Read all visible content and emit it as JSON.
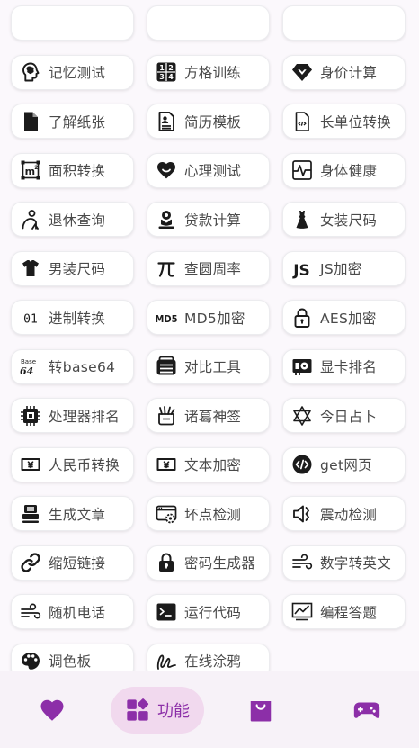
{
  "colors": {
    "accent": "#8c2fa8",
    "icon": "#1b1b1b",
    "text": "#4a4a4a",
    "active_bg": "#f1d9ee"
  },
  "tools": [
    {
      "label": "",
      "icon": "blank-icon"
    },
    {
      "label": "",
      "icon": "blank-icon"
    },
    {
      "label": "",
      "icon": "blank-icon"
    },
    {
      "label": "记忆测试",
      "icon": "brain-head-icon"
    },
    {
      "label": "方格训练",
      "icon": "number-grid-icon"
    },
    {
      "label": "身价计算",
      "icon": "diamond-icon"
    },
    {
      "label": "了解纸张",
      "icon": "paper-icon"
    },
    {
      "label": "简历模板",
      "icon": "resume-icon"
    },
    {
      "label": "长单位转换",
      "icon": "code-file-icon"
    },
    {
      "label": "面积转换",
      "icon": "area-m2-icon"
    },
    {
      "label": "心理测试",
      "icon": "heart-smile-icon"
    },
    {
      "label": "身体健康",
      "icon": "heartbeat-icon"
    },
    {
      "label": "退休查询",
      "icon": "elder-person-icon"
    },
    {
      "label": "贷款计算",
      "icon": "hand-coin-icon"
    },
    {
      "label": "女装尺码",
      "icon": "dress-icon"
    },
    {
      "label": "男装尺码",
      "icon": "tshirt-icon"
    },
    {
      "label": "查圆周率",
      "icon": "pi-icon"
    },
    {
      "label": "JS加密",
      "icon": "js-icon"
    },
    {
      "label": "进制转换",
      "icon": "binary-icon"
    },
    {
      "label": "MD5加密",
      "icon": "md5-icon"
    },
    {
      "label": "AES加密",
      "icon": "lock-icon"
    },
    {
      "label": "转base64",
      "icon": "base64-icon"
    },
    {
      "label": "对比工具",
      "icon": "compare-icon"
    },
    {
      "label": "显卡排名",
      "icon": "gpu-icon"
    },
    {
      "label": "处理器排名",
      "icon": "cpu-icon"
    },
    {
      "label": "诸葛神签",
      "icon": "fortune-jar-icon"
    },
    {
      "label": "今日占卜",
      "icon": "star-of-david-icon"
    },
    {
      "label": "人民币转换",
      "icon": "banknote-icon"
    },
    {
      "label": "文本加密",
      "icon": "text-encrypt-icon"
    },
    {
      "label": "get网页",
      "icon": "code-circle-icon"
    },
    {
      "label": "生成文章",
      "icon": "printer-icon"
    },
    {
      "label": "坏点检测",
      "icon": "screen-gear-icon"
    },
    {
      "label": "震动检测",
      "icon": "vibrate-icon"
    },
    {
      "label": "缩短链接",
      "icon": "link-icon"
    },
    {
      "label": "密码生成器",
      "icon": "password-lock-icon"
    },
    {
      "label": "数字转英文",
      "icon": "wind-icon"
    },
    {
      "label": "随机电话",
      "icon": "wind-icon"
    },
    {
      "label": "运行代码",
      "icon": "terminal-icon"
    },
    {
      "label": "编程答题",
      "icon": "chart-board-icon"
    },
    {
      "label": "调色板",
      "icon": "palette-icon"
    },
    {
      "label": "在线涂鸦",
      "icon": "scribble-icon"
    }
  ],
  "nav": {
    "items": [
      {
        "icon": "heart-icon",
        "label": ""
      },
      {
        "icon": "grid-icon",
        "label": "功能"
      },
      {
        "icon": "bag-icon",
        "label": ""
      },
      {
        "icon": "gamepad-icon",
        "label": ""
      }
    ],
    "active_index": 1
  }
}
